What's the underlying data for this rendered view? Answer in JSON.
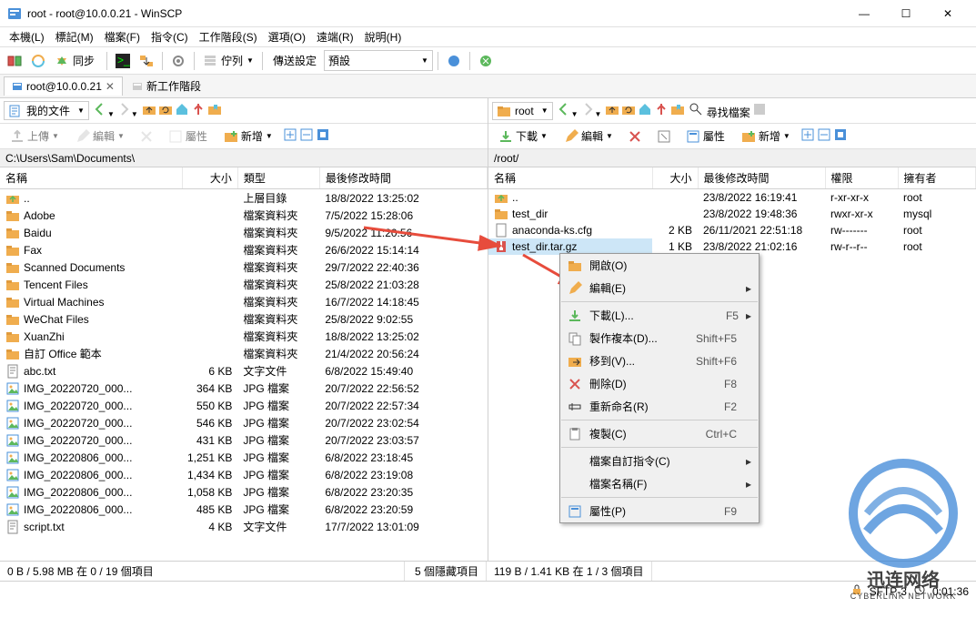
{
  "window": {
    "title": "root - root@10.0.0.21 - WinSCP",
    "minimize": "—",
    "maximize": "☐",
    "close": "✕"
  },
  "menubar": [
    "本機(L)",
    "標記(M)",
    "檔案(F)",
    "指令(C)",
    "工作階段(S)",
    "選項(O)",
    "遠端(R)",
    "說明(H)"
  ],
  "main_toolbar": {
    "sync_label": "同步",
    "queue_label": "佇列",
    "transfer_settings_label": "傳送設定",
    "preset_label": "預設"
  },
  "session_tabs": {
    "active": "root@10.0.0.21",
    "new_session": "新工作階段"
  },
  "left_panel": {
    "location": "我的文件",
    "search_placeholder": "",
    "actions": {
      "upload": "上傳",
      "edit": "編輯",
      "properties": "屬性",
      "new": "新增"
    },
    "path": "C:\\Users\\Sam\\Documents\\",
    "columns": [
      "名稱",
      "大小",
      "類型",
      "最後修改時間"
    ],
    "rows": [
      {
        "icon": "up",
        "name": "..",
        "size": "",
        "type": "上層目錄",
        "modified": "18/8/2022 13:25:02"
      },
      {
        "icon": "folder",
        "name": "Adobe",
        "size": "",
        "type": "檔案資料夾",
        "modified": "7/5/2022 15:28:06"
      },
      {
        "icon": "folder",
        "name": "Baidu",
        "size": "",
        "type": "檔案資料夾",
        "modified": "9/5/2022 11:20:56"
      },
      {
        "icon": "folder",
        "name": "Fax",
        "size": "",
        "type": "檔案資料夾",
        "modified": "26/6/2022 15:14:14"
      },
      {
        "icon": "folder",
        "name": "Scanned Documents",
        "size": "",
        "type": "檔案資料夾",
        "modified": "29/7/2022 22:40:36"
      },
      {
        "icon": "folder",
        "name": "Tencent Files",
        "size": "",
        "type": "檔案資料夾",
        "modified": "25/8/2022 21:03:28"
      },
      {
        "icon": "folder",
        "name": "Virtual Machines",
        "size": "",
        "type": "檔案資料夾",
        "modified": "16/7/2022 14:18:45"
      },
      {
        "icon": "folder",
        "name": "WeChat Files",
        "size": "",
        "type": "檔案資料夾",
        "modified": "25/8/2022 9:02:55"
      },
      {
        "icon": "folder",
        "name": "XuanZhi",
        "size": "",
        "type": "檔案資料夾",
        "modified": "18/8/2022 13:25:02"
      },
      {
        "icon": "folder",
        "name": "自訂 Office 範本",
        "size": "",
        "type": "檔案資料夾",
        "modified": "21/4/2022 20:56:24"
      },
      {
        "icon": "text",
        "name": "abc.txt",
        "size": "6 KB",
        "type": "文字文件",
        "modified": "6/8/2022 15:49:40"
      },
      {
        "icon": "image",
        "name": "IMG_20220720_000...",
        "size": "364 KB",
        "type": "JPG 檔案",
        "modified": "20/7/2022 22:56:52"
      },
      {
        "icon": "image",
        "name": "IMG_20220720_000...",
        "size": "550 KB",
        "type": "JPG 檔案",
        "modified": "20/7/2022 22:57:34"
      },
      {
        "icon": "image",
        "name": "IMG_20220720_000...",
        "size": "546 KB",
        "type": "JPG 檔案",
        "modified": "20/7/2022 23:02:54"
      },
      {
        "icon": "image",
        "name": "IMG_20220720_000...",
        "size": "431 KB",
        "type": "JPG 檔案",
        "modified": "20/7/2022 23:03:57"
      },
      {
        "icon": "image",
        "name": "IMG_20220806_000...",
        "size": "1,251 KB",
        "type": "JPG 檔案",
        "modified": "6/8/2022 23:18:45"
      },
      {
        "icon": "image",
        "name": "IMG_20220806_000...",
        "size": "1,434 KB",
        "type": "JPG 檔案",
        "modified": "6/8/2022 23:19:08"
      },
      {
        "icon": "image",
        "name": "IMG_20220806_000...",
        "size": "1,058 KB",
        "type": "JPG 檔案",
        "modified": "6/8/2022 23:20:35"
      },
      {
        "icon": "image",
        "name": "IMG_20220806_000...",
        "size": "485 KB",
        "type": "JPG 檔案",
        "modified": "6/8/2022 23:20:59"
      },
      {
        "icon": "text",
        "name": "script.txt",
        "size": "4 KB",
        "type": "文字文件",
        "modified": "17/7/2022 13:01:09"
      }
    ]
  },
  "right_panel": {
    "location": "root",
    "search_label": "尋找檔案",
    "actions": {
      "download": "下載",
      "edit": "編輯",
      "properties": "屬性",
      "new": "新增"
    },
    "path": "/root/",
    "columns": [
      "名稱",
      "大小",
      "最後修改時間",
      "權限",
      "擁有者"
    ],
    "rows": [
      {
        "icon": "up",
        "name": "..",
        "size": "",
        "modified": "23/8/2022 16:19:41",
        "perm": "r-xr-xr-x",
        "owner": "root",
        "sel": false
      },
      {
        "icon": "folder",
        "name": "test_dir",
        "size": "",
        "modified": "23/8/2022 19:48:36",
        "perm": "rwxr-xr-x",
        "owner": "mysql",
        "sel": false
      },
      {
        "icon": "file",
        "name": "anaconda-ks.cfg",
        "size": "2 KB",
        "modified": "26/11/2021 22:51:18",
        "perm": "rw-------",
        "owner": "root",
        "sel": false
      },
      {
        "icon": "archive",
        "name": "test_dir.tar.gz",
        "size": "1 KB",
        "modified": "23/8/2022 21:02:16",
        "perm": "rw-r--r--",
        "owner": "root",
        "sel": true
      }
    ]
  },
  "context_menu": [
    {
      "type": "item",
      "icon": "open",
      "label": "開啟(O)",
      "shortcut": "",
      "arrow": false
    },
    {
      "type": "item",
      "icon": "edit",
      "label": "編輯(E)",
      "shortcut": "",
      "arrow": true
    },
    {
      "type": "sep"
    },
    {
      "type": "item",
      "icon": "download",
      "label": "下載(L)...",
      "shortcut": "F5",
      "arrow": true
    },
    {
      "type": "item",
      "icon": "copy",
      "label": "製作複本(D)...",
      "shortcut": "Shift+F5",
      "arrow": false
    },
    {
      "type": "item",
      "icon": "move",
      "label": "移到(V)...",
      "shortcut": "Shift+F6",
      "arrow": false
    },
    {
      "type": "item",
      "icon": "delete",
      "label": "刪除(D)",
      "shortcut": "F8",
      "arrow": false
    },
    {
      "type": "item",
      "icon": "rename",
      "label": "重新命名(R)",
      "shortcut": "F2",
      "arrow": false
    },
    {
      "type": "sep"
    },
    {
      "type": "item",
      "icon": "clipboard",
      "label": "複製(C)",
      "shortcut": "Ctrl+C",
      "arrow": false
    },
    {
      "type": "sep"
    },
    {
      "type": "item",
      "icon": "",
      "label": "檔案自訂指令(C)",
      "shortcut": "",
      "arrow": true
    },
    {
      "type": "item",
      "icon": "",
      "label": "檔案名稱(F)",
      "shortcut": "",
      "arrow": true
    },
    {
      "type": "sep"
    },
    {
      "type": "item",
      "icon": "props",
      "label": "屬性(P)",
      "shortcut": "F9",
      "arrow": false
    }
  ],
  "statusbar": {
    "left": "0 B / 5.98 MB 在 0 / 19 個項目",
    "hidden": "5 個隱藏項目",
    "right": "119 B / 1.41 KB 在 1 / 3 個項目"
  },
  "connection": {
    "protocol": "SFTP-3",
    "time": "0:01:36"
  },
  "watermark": {
    "brand": "迅连网络",
    "sub": "CYBERLINK NETWORK"
  },
  "colors": {
    "accent": "#2b7cd3",
    "selection": "#cde6f7",
    "border": "#d0d0d0"
  }
}
